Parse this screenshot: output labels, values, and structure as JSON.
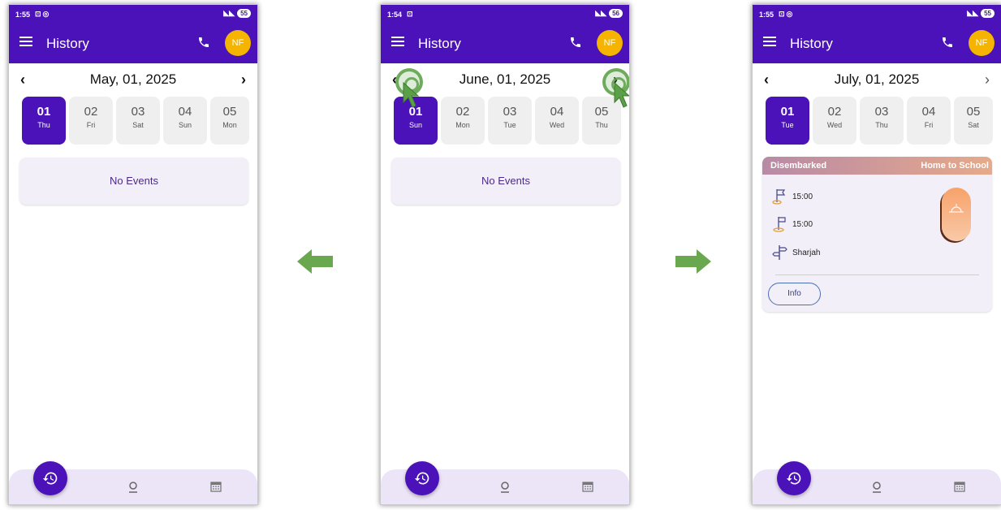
{
  "colors": {
    "primary": "#4a12b8",
    "avatar": "#f4b400",
    "arrow": "#6aa84f",
    "card": "#f3eff8"
  },
  "screens": [
    {
      "status": {
        "time": "1:55",
        "battery": "55"
      },
      "app_title": "History",
      "avatar": "NF",
      "date": "May, 01, 2025",
      "days": [
        {
          "num": "01",
          "wk": "Thu",
          "selected": true
        },
        {
          "num": "02",
          "wk": "Fri"
        },
        {
          "num": "03",
          "wk": "Sat"
        },
        {
          "num": "04",
          "wk": "Sun"
        },
        {
          "num": "05",
          "wk": "Mon"
        }
      ],
      "empty_text": "No Events"
    },
    {
      "status": {
        "time": "1:54",
        "battery": "56"
      },
      "app_title": "History",
      "avatar": "NF",
      "date": "June, 01, 2025",
      "days": [
        {
          "num": "01",
          "wk": "Sun",
          "selected": true
        },
        {
          "num": "02",
          "wk": "Mon"
        },
        {
          "num": "03",
          "wk": "Tue"
        },
        {
          "num": "04",
          "wk": "Wed"
        },
        {
          "num": "05",
          "wk": "Thu"
        }
      ],
      "empty_text": "No Events"
    },
    {
      "status": {
        "time": "1:55",
        "battery": "55"
      },
      "app_title": "History",
      "avatar": "NF",
      "date": "July, 01, 2025",
      "days": [
        {
          "num": "01",
          "wk": "Tue",
          "selected": true
        },
        {
          "num": "02",
          "wk": "Wed"
        },
        {
          "num": "03",
          "wk": "Thu"
        },
        {
          "num": "04",
          "wk": "Fri"
        },
        {
          "num": "05",
          "wk": "Sat"
        }
      ],
      "event": {
        "status": "Disembarked",
        "route": "Home to School",
        "start_time": "15:00",
        "end_time": "15:00",
        "location": "Sharjah",
        "info_label": "Info"
      }
    }
  ],
  "icons": {
    "menu": "menu-icon",
    "call": "phone-icon",
    "prev": "chevron-left-icon",
    "next": "chevron-right-icon",
    "history": "history-icon",
    "location": "location-pin-icon",
    "calendar": "calendar-icon",
    "start": "start-flag-icon",
    "end": "end-flag-icon",
    "place": "signpost-icon"
  }
}
